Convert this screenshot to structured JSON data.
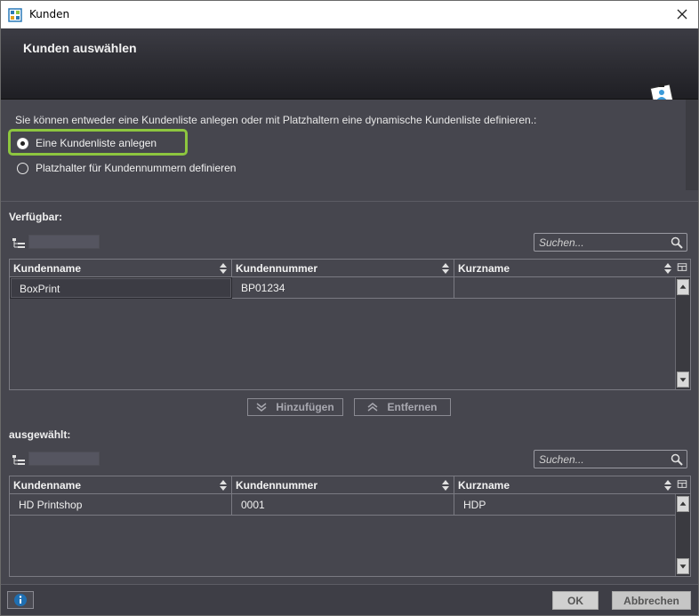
{
  "window": {
    "title": "Kunden",
    "close_icon": "close-icon",
    "app_icon": "customer-app-icon"
  },
  "header": {
    "title": "Kunden auswählen",
    "icon": "customer-card-icon"
  },
  "intro": "Sie können entweder eine Kundenliste anlegen oder mit Platzhaltern eine dynamische Kundenliste definieren.:",
  "options": [
    {
      "label": "Eine Kundenliste anlegen",
      "selected": true
    },
    {
      "label": "Platzhalter für Kundennummern definieren",
      "selected": false
    }
  ],
  "available": {
    "label": "Verfügbar:",
    "search_placeholder": "Suchen...",
    "columns": [
      "Kundenname",
      "Kundennummer",
      "Kurzname"
    ],
    "rows": [
      [
        "BoxPrint",
        "BP01234",
        ""
      ]
    ]
  },
  "actions": {
    "add": "Hinzufügen",
    "remove": "Entfernen"
  },
  "selected": {
    "label": "ausgewählt:",
    "search_placeholder": "Suchen...",
    "columns": [
      "Kundenname",
      "Kundennummer",
      "Kurzname"
    ],
    "rows": [
      [
        "HD Printshop",
        "0001",
        "HDP"
      ]
    ]
  },
  "footer": {
    "ok": "OK",
    "cancel": "Abbrechen",
    "info_icon": "info-icon"
  },
  "colors": {
    "highlight": "#8dc63f",
    "panel": "#46464e",
    "header_dark": "#1f1f24",
    "info_blue": "#1f6fb2"
  }
}
